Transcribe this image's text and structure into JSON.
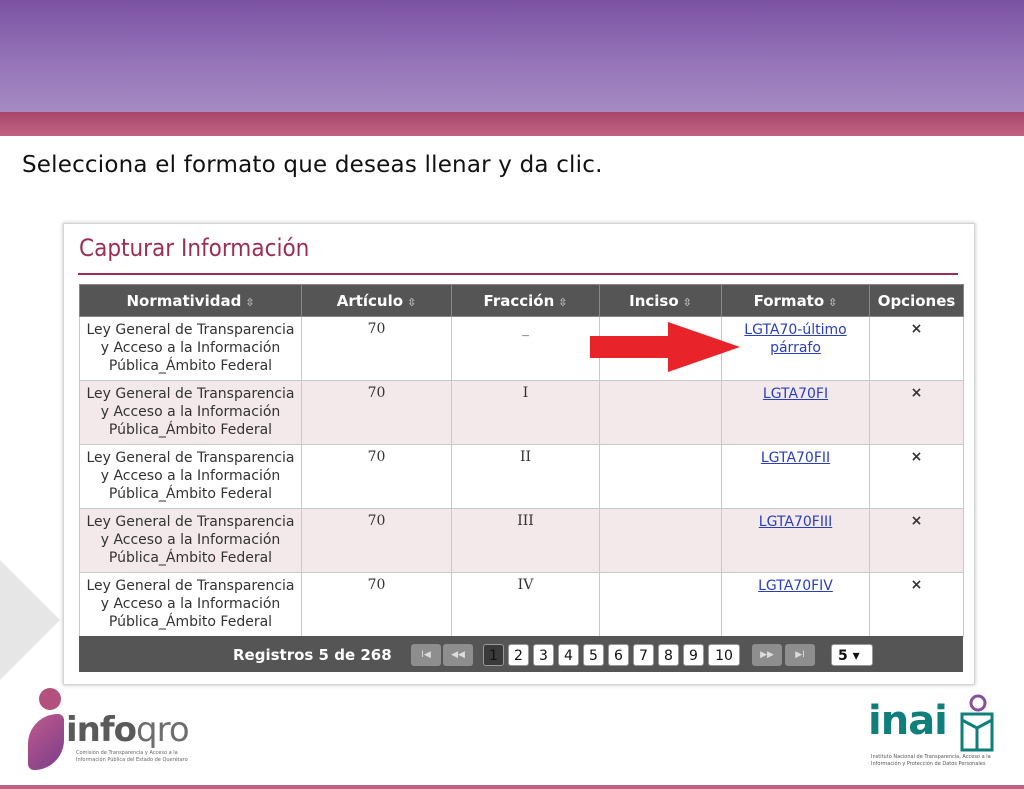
{
  "instruction": "Selecciona el formato que deseas llenar y da clic.",
  "panel": {
    "title": "Capturar Información",
    "columns": [
      "Normatividad",
      "Artículo",
      "Fracción",
      "Inciso",
      "Formato",
      "Opciones"
    ],
    "sort_icon": "⇳",
    "rows": [
      {
        "normatividad": "Ley General de Transparencia y Acceso a la Información Pública_Ámbito Federal",
        "articulo": "70",
        "fraccion": "_",
        "inciso": "",
        "formato": "LGTA70-último párrafo",
        "opcion": "×"
      },
      {
        "normatividad": "Ley General de Transparencia y Acceso a la Información Pública_Ámbito Federal",
        "articulo": "70",
        "fraccion": "I",
        "inciso": "",
        "formato": "LGTA70FI",
        "opcion": "×"
      },
      {
        "normatividad": "Ley General de Transparencia y Acceso a la Información Pública_Ámbito Federal",
        "articulo": "70",
        "fraccion": "II",
        "inciso": "",
        "formato": "LGTA70FII",
        "opcion": "×"
      },
      {
        "normatividad": "Ley General de Transparencia y Acceso a la Información Pública_Ámbito Federal",
        "articulo": "70",
        "fraccion": "III",
        "inciso": "",
        "formato": "LGTA70FIII",
        "opcion": "×"
      },
      {
        "normatividad": "Ley General de Transparencia y Acceso a la Información Pública_Ámbito Federal",
        "articulo": "70",
        "fraccion": "IV",
        "inciso": "",
        "formato": "LGTA70FIV",
        "opcion": "×"
      }
    ],
    "pager": {
      "records": "Registros 5 de 268",
      "first": "I◀",
      "prev": "◀◀",
      "pages": [
        "1",
        "2",
        "3",
        "4",
        "5",
        "6",
        "7",
        "8",
        "9",
        "10"
      ],
      "current_page": "1",
      "next": "▶▶",
      "last": "▶I",
      "page_size": "5 ▾"
    }
  },
  "logos": {
    "left_word_bold": "info",
    "left_word": "qro",
    "left_sub": "Comisión de Transparencia y Acceso a la Información Pública del Estado de Querétaro",
    "right_word": "inai",
    "right_sub": "Instituto Nacional de Transparencia, Acceso a la Información y Protección de Datos Personales"
  },
  "colors": {
    "header_band": "#7b52a3",
    "accent": "#9e2d55",
    "table_header": "#555555",
    "link": "#2a3fbf",
    "arrow": "#e8232a",
    "inai": "#0e7f7a"
  }
}
